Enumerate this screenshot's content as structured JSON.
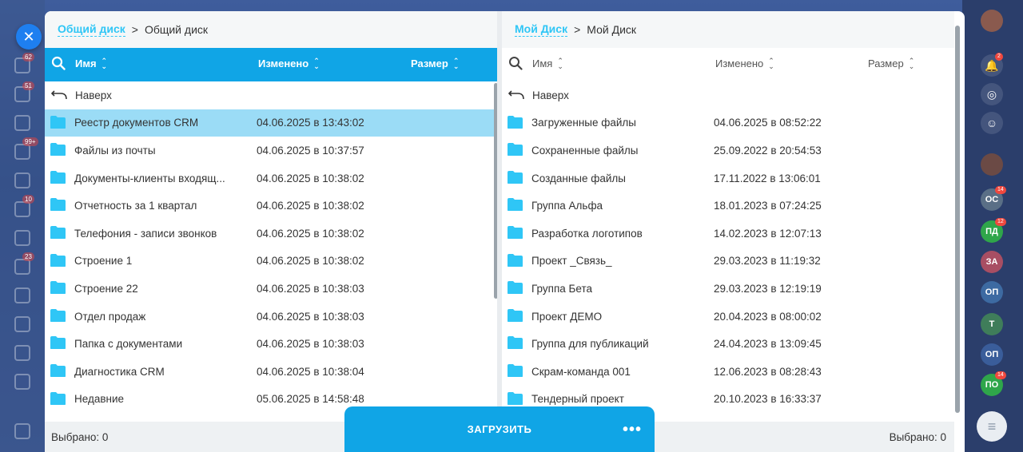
{
  "left_pane": {
    "breadcrumb_link": "Общий диск",
    "breadcrumb_sep": ">",
    "breadcrumb_current": "Общий диск",
    "columns": {
      "name": "Имя",
      "modified": "Изменено",
      "size": "Размер"
    },
    "up_label": "Наверх",
    "rows": [
      {
        "name": "Реестр документов CRM",
        "date": "04.06.2025 в 13:43:02"
      },
      {
        "name": "Файлы из почты",
        "date": "04.06.2025 в 10:37:57"
      },
      {
        "name": "Документы-клиенты входящ...",
        "date": "04.06.2025 в 10:38:02"
      },
      {
        "name": "Отчетность за 1 квартал",
        "date": "04.06.2025 в 10:38:02"
      },
      {
        "name": "Телефония - записи звонков",
        "date": "04.06.2025 в 10:38:02"
      },
      {
        "name": "Строение 1",
        "date": "04.06.2025 в 10:38:02"
      },
      {
        "name": "Строение 22",
        "date": "04.06.2025 в 10:38:03"
      },
      {
        "name": "Отдел продаж",
        "date": "04.06.2025 в 10:38:03"
      },
      {
        "name": "Папка с документами",
        "date": "04.06.2025 в 10:38:03"
      },
      {
        "name": "Диагностика CRM",
        "date": "04.06.2025 в 10:38:04"
      },
      {
        "name": "Недавние",
        "date": "05.06.2025 в 14:58:48"
      }
    ],
    "selected_footer": "Выбрано: 0"
  },
  "right_pane": {
    "breadcrumb_link": "Мой Диск",
    "breadcrumb_sep": ">",
    "breadcrumb_current": "Мой Диск",
    "columns": {
      "name": "Имя",
      "modified": "Изменено",
      "size": "Размер"
    },
    "up_label": "Наверх",
    "rows": [
      {
        "name": "Загруженные файлы",
        "date": "04.06.2025 в 08:52:22"
      },
      {
        "name": "Сохраненные файлы",
        "date": "25.09.2022 в 20:54:53"
      },
      {
        "name": "Созданные файлы",
        "date": "17.11.2022 в 13:06:01"
      },
      {
        "name": "Группа Альфа",
        "date": "18.01.2023 в 07:24:25"
      },
      {
        "name": "Разработка логотипов",
        "date": "14.02.2023 в 12:07:13"
      },
      {
        "name": "Проект _Связь_",
        "date": "29.03.2023 в 11:19:32"
      },
      {
        "name": "Группа Бета",
        "date": "29.03.2023 в 12:19:19"
      },
      {
        "name": "Проект ДЕМО",
        "date": "20.04.2023 в 08:00:02"
      },
      {
        "name": "Группа для публикаций",
        "date": "24.04.2023 в 13:09:45"
      },
      {
        "name": "Скрам-команда 001",
        "date": "12.06.2023 в 08:28:43"
      },
      {
        "name": "Тендерный проект",
        "date": "20.10.2023 в 16:33:37"
      }
    ],
    "selected_footer": "Выбрано: 0"
  },
  "upload_button": {
    "label": "ЗАГРУЗИТЬ",
    "more": "•••"
  },
  "close_button": {
    "label": "✕"
  },
  "right_sidebar": {
    "notif_badge": "2",
    "avatars": [
      {
        "initials": "ОС",
        "badge": "14",
        "color": "#5a6f86"
      },
      {
        "initials": "ПД",
        "badge": "12",
        "color": "#2fa64a"
      },
      {
        "initials": "ЗА",
        "badge": "",
        "color": "#a84e63"
      },
      {
        "initials": "ОП",
        "badge": "",
        "color": "#3d6aa2"
      },
      {
        "initials": "Т",
        "badge": "",
        "color": "#3f7d5a"
      },
      {
        "initials": "ОП",
        "badge": "",
        "color": "#3a5d9a"
      },
      {
        "initials": "ПО",
        "badge": "14",
        "color": "#2fa64a"
      }
    ]
  },
  "left_sidebar_badges": [
    "62",
    "51",
    "99+",
    "10",
    "23"
  ],
  "colors": {
    "accent": "#10a5e6",
    "link": "#2fc6f6",
    "selected_row": "#9bdcf6",
    "folder": "#2fc6f6"
  }
}
